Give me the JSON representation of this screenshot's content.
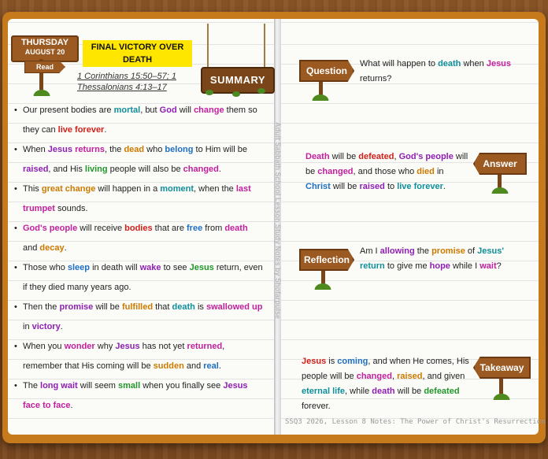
{
  "day": {
    "weekday": "THURSDAY",
    "date": "AUGUST 20",
    "read_label": "Read"
  },
  "title": "FINAL VICTORY OVER DEATH",
  "refs": [
    "1 Corinthians 15:50–57; 1",
    "Thessalonians 4:13–17"
  ],
  "summary_label": "SUMMARY",
  "bullets": [
    [
      {
        "t": "Our present bodies are "
      },
      {
        "t": "mortal",
        "c": "teal"
      },
      {
        "t": ", but "
      },
      {
        "t": "God",
        "c": "purple"
      },
      {
        "t": " will "
      },
      {
        "t": "change",
        "c": "magenta"
      },
      {
        "t": " them so they can "
      },
      {
        "t": "live forever",
        "c": "red"
      },
      {
        "t": "."
      }
    ],
    [
      {
        "t": "When "
      },
      {
        "t": "Jesus",
        "c": "purple"
      },
      {
        "t": " "
      },
      {
        "t": "returns",
        "c": "magenta"
      },
      {
        "t": ", the "
      },
      {
        "t": "dead",
        "c": "orange"
      },
      {
        "t": " who "
      },
      {
        "t": "belong",
        "c": "blue"
      },
      {
        "t": " to Him will be "
      },
      {
        "t": "raised",
        "c": "purple"
      },
      {
        "t": ", and His "
      },
      {
        "t": "living",
        "c": "green"
      },
      {
        "t": " people will also be "
      },
      {
        "t": "changed",
        "c": "magenta"
      },
      {
        "t": "."
      }
    ],
    [
      {
        "t": "This "
      },
      {
        "t": "great change",
        "c": "orange"
      },
      {
        "t": " will happen in a "
      },
      {
        "t": "moment",
        "c": "teal"
      },
      {
        "t": ", when the "
      },
      {
        "t": "last trumpet",
        "c": "magenta"
      },
      {
        "t": " sounds."
      }
    ],
    [
      {
        "t": "God's people",
        "c": "magenta"
      },
      {
        "t": " will receive "
      },
      {
        "t": "bodies",
        "c": "red"
      },
      {
        "t": " that are "
      },
      {
        "t": "free",
        "c": "blue"
      },
      {
        "t": " from "
      },
      {
        "t": "death",
        "c": "magenta"
      },
      {
        "t": " and "
      },
      {
        "t": "decay",
        "c": "orange"
      },
      {
        "t": "."
      }
    ],
    [
      {
        "t": "Those who "
      },
      {
        "t": "sleep",
        "c": "blue"
      },
      {
        "t": " in death will "
      },
      {
        "t": "wake",
        "c": "purple"
      },
      {
        "t": " to see "
      },
      {
        "t": "Jesus",
        "c": "green"
      },
      {
        "t": " return, even if they died many years ago."
      }
    ],
    [
      {
        "t": "Then the "
      },
      {
        "t": "promise",
        "c": "purple"
      },
      {
        "t": " will be "
      },
      {
        "t": "fulfilled",
        "c": "orange"
      },
      {
        "t": " that "
      },
      {
        "t": "death",
        "c": "teal"
      },
      {
        "t": " is "
      },
      {
        "t": "swallowed up",
        "c": "magenta"
      },
      {
        "t": " in "
      },
      {
        "t": "victory",
        "c": "purple"
      },
      {
        "t": "."
      }
    ],
    [
      {
        "t": "When you "
      },
      {
        "t": "wonder",
        "c": "magenta"
      },
      {
        "t": " why "
      },
      {
        "t": "Jesus",
        "c": "purple"
      },
      {
        "t": " has not yet "
      },
      {
        "t": "returned",
        "c": "magenta"
      },
      {
        "t": ", remember that His coming will be "
      },
      {
        "t": "sudden",
        "c": "orange"
      },
      {
        "t": " and "
      },
      {
        "t": "real",
        "c": "blue"
      },
      {
        "t": "."
      }
    ],
    [
      {
        "t": "The "
      },
      {
        "t": "long wait",
        "c": "purple"
      },
      {
        "t": " will seem "
      },
      {
        "t": "small",
        "c": "green"
      },
      {
        "t": " when you finally see "
      },
      {
        "t": "Jesus",
        "c": "purple"
      },
      {
        "t": " "
      },
      {
        "t": "face to face",
        "c": "magenta"
      },
      {
        "t": "."
      }
    ]
  ],
  "vertical_credit": "Adult Sabbath School Lesson Study Notes by Shofarpulse",
  "signs": {
    "question": "Question",
    "answer": "Answer",
    "reflection": "Reflection",
    "takeaway": "Takeaway"
  },
  "question": [
    {
      "t": "What will happen to "
    },
    {
      "t": "death",
      "c": "teal"
    },
    {
      "t": " when "
    },
    {
      "t": "Jesus",
      "c": "magenta"
    },
    {
      "t": " returns?"
    }
  ],
  "answer": [
    {
      "t": "Death",
      "c": "magenta"
    },
    {
      "t": " will be "
    },
    {
      "t": "defeated",
      "c": "red"
    },
    {
      "t": ", "
    },
    {
      "t": "God's people",
      "c": "purple"
    },
    {
      "t": " will be "
    },
    {
      "t": "changed",
      "c": "magenta"
    },
    {
      "t": ", and those who "
    },
    {
      "t": "died",
      "c": "orange"
    },
    {
      "t": " in "
    },
    {
      "t": "Christ",
      "c": "blue"
    },
    {
      "t": " will be "
    },
    {
      "t": "raised",
      "c": "purple"
    },
    {
      "t": " to "
    },
    {
      "t": "live forever",
      "c": "teal"
    },
    {
      "t": "."
    }
  ],
  "reflection": [
    {
      "t": "Am I "
    },
    {
      "t": "allowing",
      "c": "purple"
    },
    {
      "t": " the "
    },
    {
      "t": "promise",
      "c": "orange"
    },
    {
      "t": " of "
    },
    {
      "t": "Jesus' return",
      "c": "teal"
    },
    {
      "t": " to give me "
    },
    {
      "t": "hope",
      "c": "purple"
    },
    {
      "t": " while I "
    },
    {
      "t": "wait",
      "c": "magenta"
    },
    {
      "t": "?"
    }
  ],
  "takeaway": [
    {
      "t": "Jesus",
      "c": "red"
    },
    {
      "t": " is "
    },
    {
      "t": "coming",
      "c": "blue"
    },
    {
      "t": ", and when He comes, His people will be "
    },
    {
      "t": "changed",
      "c": "magenta"
    },
    {
      "t": ", "
    },
    {
      "t": "raised",
      "c": "orange"
    },
    {
      "t": ", and given "
    },
    {
      "t": "eternal life",
      "c": "teal"
    },
    {
      "t": ", while "
    },
    {
      "t": "death",
      "c": "purple"
    },
    {
      "t": " will be "
    },
    {
      "t": "defeated",
      "c": "green"
    },
    {
      "t": " forever."
    }
  ],
  "footer": "SSQ3 2026, Lesson 8 Notes: The Power of Christ's Resurrection"
}
